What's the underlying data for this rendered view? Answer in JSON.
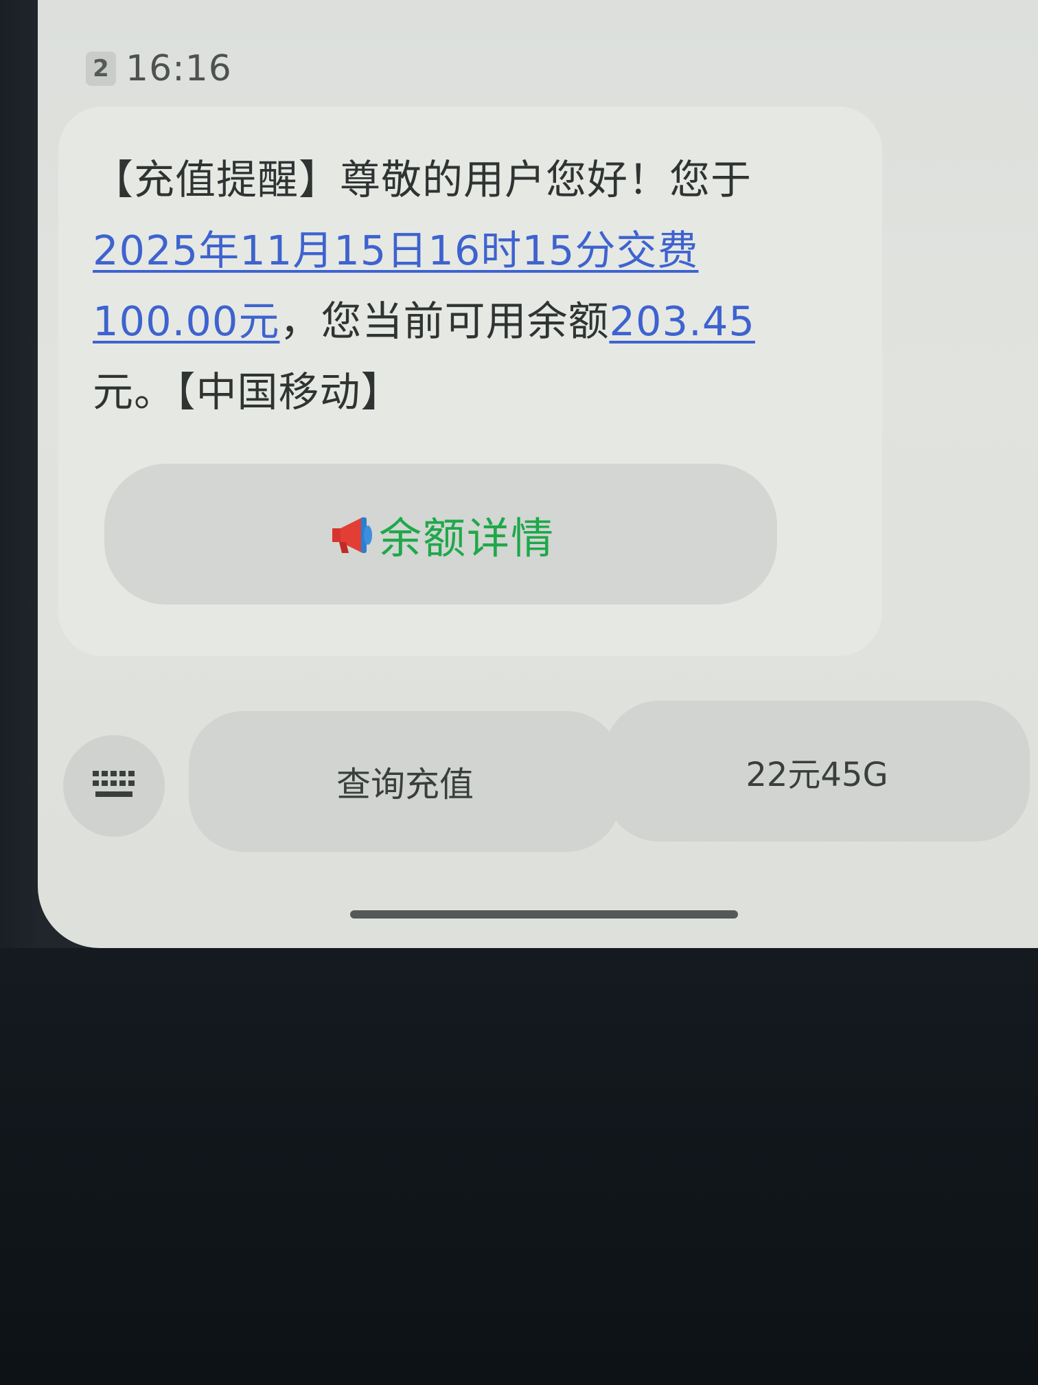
{
  "header": {
    "sim_slot": "2",
    "time": "16:16"
  },
  "message": {
    "text_before_date": "【充值提醒】尊敬的用户您好！您于",
    "date_link": "2025年11月15日16时15分交费",
    "amount_link": "100.00元",
    "text_middle": "，您当前可用余额",
    "balance_link": "203.45",
    "text_end": "元。【中国移动】"
  },
  "card_button": {
    "icon": "megaphone-icon",
    "label": "余额详情"
  },
  "quick_replies": {
    "keyboard_icon": "keyboard-icon",
    "items": [
      {
        "label": "查询充值"
      },
      {
        "label": "22元45G"
      }
    ]
  },
  "colors": {
    "link": "#3e63cf",
    "detail_green": "#1ea84a"
  }
}
